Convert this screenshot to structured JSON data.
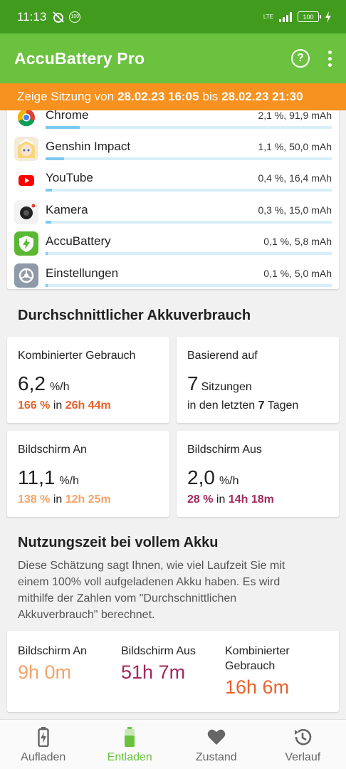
{
  "status_bar": {
    "time": "11:13",
    "notification_badge": "100",
    "network": "LTE",
    "battery": "100"
  },
  "app_bar": {
    "title": "AccuBattery Pro",
    "help_icon": "help-circle-icon",
    "menu_icon": "more-vert-icon"
  },
  "session_banner": {
    "prefix": "Zeige Sitzung von",
    "start": "28.02.23 16:05",
    "middle": "bis",
    "end": "28.02.23 21:30"
  },
  "apps": [
    {
      "name": "Chrome",
      "value": "2,1 %, 91,9 mAh",
      "share": 0.12,
      "icon": "chrome-icon"
    },
    {
      "name": "Genshin Impact",
      "value": "1,1 %, 50,0 mAh",
      "share": 0.065,
      "icon": "genshin-impact-icon"
    },
    {
      "name": "YouTube",
      "value": "0,4 %, 16,4 mAh",
      "share": 0.022,
      "icon": "youtube-icon"
    },
    {
      "name": "Kamera",
      "value": "0,3 %, 15,0 mAh",
      "share": 0.02,
      "icon": "camera-icon"
    },
    {
      "name": "AccuBattery",
      "value": "0,1 %, 5,8 mAh",
      "share": 0.008,
      "icon": "accubattery-icon"
    },
    {
      "name": "Einstellungen",
      "value": "0,1 %, 5,0 mAh",
      "share": 0.007,
      "icon": "settings-icon"
    }
  ],
  "avg_usage": {
    "title": "Durchschnittlicher Akkuverbrauch",
    "combined": {
      "label": "Kombinierter Gebrauch",
      "value": "6,2",
      "unit": "%/h",
      "percent": "166 %",
      "in": "in",
      "duration": "26h 44m",
      "color": "#e8622c"
    },
    "based_on": {
      "label": "Basierend auf",
      "value": "7",
      "unit": "Sitzungen",
      "sub_prefix": "in den letzten",
      "days": "7",
      "sub_suffix": "Tagen"
    },
    "screen_on": {
      "label": "Bildschirm An",
      "value": "11,1",
      "unit": "%/h",
      "percent": "138 %",
      "in": "in",
      "duration": "12h 25m",
      "color": "#f4a46a"
    },
    "screen_off": {
      "label": "Bildschirm Aus",
      "value": "2,0",
      "unit": "%/h",
      "percent": "28 %",
      "in": "in",
      "duration": "14h 18m",
      "color": "#a3285e"
    }
  },
  "full_charge": {
    "title": "Nutzungszeit bei vollem Akku",
    "description": "Diese Schätzung sagt Ihnen, wie viel Laufzeit Sie mit einem 100% voll aufgeladenen Akku haben. Es wird mithilfe der Zahlen vom \"Durchschnittlichen Akkuverbrauch\" berechnet.",
    "screen_on": {
      "label": "Bildschirm An",
      "value": "9h 0m",
      "color": "#f4a46a"
    },
    "screen_off": {
      "label": "Bildschirm Aus",
      "value": "51h 7m",
      "color": "#a3285e"
    },
    "combined": {
      "label": "Kombinierter Gebrauch",
      "value": "16h 6m",
      "color": "#e8622c"
    }
  },
  "bottom_nav": [
    {
      "label": "Aufladen",
      "icon": "battery-charging-icon",
      "active": false
    },
    {
      "label": "Entladen",
      "icon": "battery-discharging-icon",
      "active": true
    },
    {
      "label": "Zustand",
      "icon": "heart-icon",
      "active": false
    },
    {
      "label": "Verlauf",
      "icon": "history-icon",
      "active": false
    }
  ],
  "colors": {
    "status_bar": "#419b1d",
    "app_bar": "#6bc23f",
    "banner": "#f7911f",
    "accent": "#6bc23f",
    "usage_bar": "#7cc8ef"
  }
}
